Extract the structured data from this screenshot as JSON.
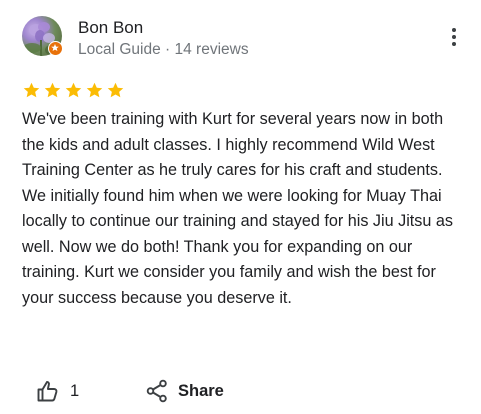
{
  "review": {
    "author_name": "Bon Bon",
    "author_meta": "Local Guide · 14 reviews",
    "rating": 5,
    "rating_max": 5,
    "text": "We've been training with Kurt for several years now in both the kids and adult classes. I highly recommend Wild West Training Center as he truly cares for his craft and students. We initially found him when we were looking for Muay Thai locally to continue our training and stayed for his Jiu Jitsu as well. Now we do both! Thank you for expanding on our training. Kurt we consider you family and wish the best for your success because you deserve it.",
    "like_count": "1",
    "share_label": "Share"
  },
  "icons": {
    "more": "more-vert-icon",
    "star": "star-icon",
    "like": "thumb-up-icon",
    "share": "share-icon",
    "badge": "local-guide-badge-icon"
  },
  "colors": {
    "star": "#fbbc04",
    "badge": "#e8710a",
    "text": "#202124",
    "secondary_text": "#70757a"
  }
}
